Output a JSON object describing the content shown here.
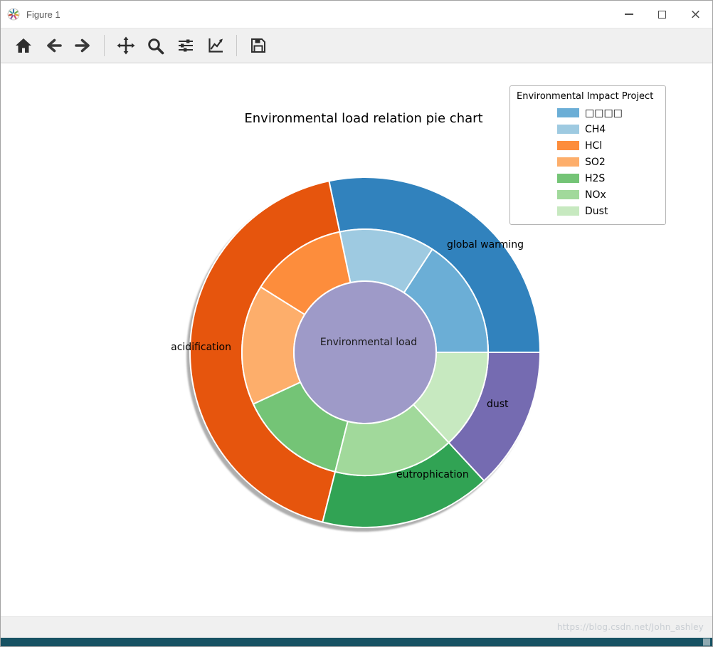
{
  "window": {
    "title": "Figure 1",
    "controls": {
      "close_glyph": "×"
    }
  },
  "toolbar": {
    "buttons": [
      "home",
      "back",
      "forward",
      "separator",
      "pan",
      "zoom",
      "configure-subplots",
      "edit-axes",
      "separator",
      "save"
    ]
  },
  "chart_data": {
    "type": "pie",
    "variant": "nested-donut",
    "title": "Environmental load relation pie chart",
    "center_label": "Environmental load",
    "center_color": "#9e9ac8",
    "start_angle_deg": 0,
    "direction": "counterclockwise",
    "outer_ring": [
      {
        "label": "global warming",
        "value_pct": 28.3,
        "color": "#3182bd"
      },
      {
        "label": "acidification",
        "value_pct": 42.8,
        "color": "#e6550d"
      },
      {
        "label": "eutrophication",
        "value_pct": 15.8,
        "color": "#31a354"
      },
      {
        "label": "dust",
        "value_pct": 13.1,
        "color": "#756bb1"
      }
    ],
    "inner_ring": [
      {
        "label": "□□□□",
        "value_pct": 15.8,
        "color": "#6baed6"
      },
      {
        "label": "CH4",
        "value_pct": 12.5,
        "color": "#9ecae1"
      },
      {
        "label": "HCl",
        "value_pct": 12.8,
        "color": "#fd8d3c"
      },
      {
        "label": "SO2",
        "value_pct": 15.8,
        "color": "#fdae6b"
      },
      {
        "label": "H2S",
        "value_pct": 14.2,
        "color": "#74c476"
      },
      {
        "label": "NOx",
        "value_pct": 15.8,
        "color": "#a1d99b"
      },
      {
        "label": "Dust",
        "value_pct": 13.1,
        "color": "#c7e9c0"
      }
    ]
  },
  "legend": {
    "title": "Environmental Impact Project",
    "entries": [
      {
        "label": "□□□□",
        "color": "#6baed6"
      },
      {
        "label": "CH4",
        "color": "#9ecae1"
      },
      {
        "label": "HCl",
        "color": "#fd8d3c"
      },
      {
        "label": "SO2",
        "color": "#fdae6b"
      },
      {
        "label": "H2S",
        "color": "#74c476"
      },
      {
        "label": "NOx",
        "color": "#a1d99b"
      },
      {
        "label": "Dust",
        "color": "#c7e9c0"
      }
    ]
  },
  "footer": {
    "watermark": "https://blog.csdn.net/John_ashley"
  }
}
